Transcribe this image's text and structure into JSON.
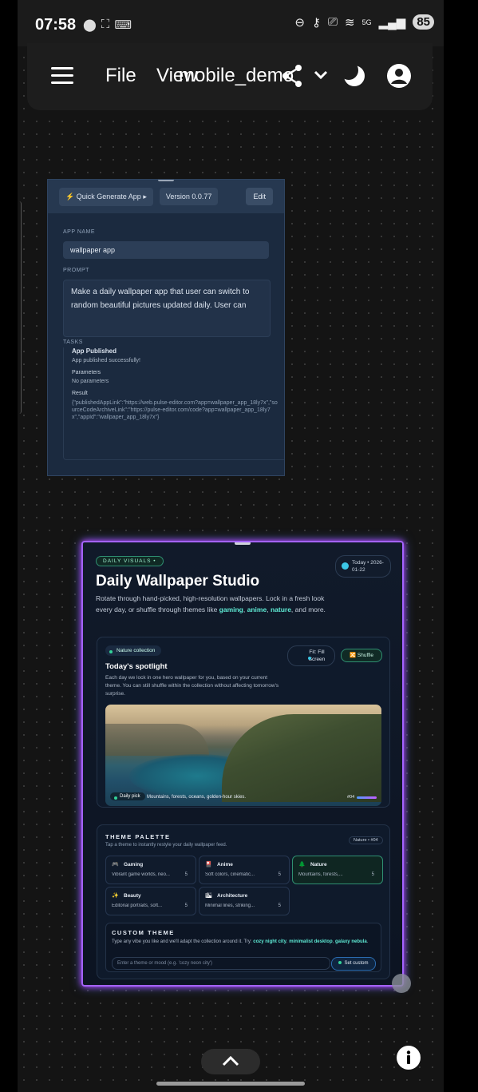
{
  "status_bar": {
    "time": "07:58",
    "network": "5G",
    "battery": "85"
  },
  "app_bar": {
    "file_label": "File",
    "view_label": "View",
    "project_name": "mobile_demo"
  },
  "quick_generate": {
    "title": "Quick Generate App",
    "version": "Version 0.0.77",
    "edit_label": "Edit",
    "app_name_label": "APP NAME",
    "app_name_value": "wallpaper app",
    "prompt_label": "PROMPT",
    "prompt_value": "Make a daily wallpaper app that user can switch to random beautiful pictures updated daily. User can",
    "tasks_label": "TASKS",
    "task_title": "App Published",
    "task_message": "App published successfully!",
    "parameters_label": "Parameters",
    "parameters_value": "No parameters",
    "result_label": "Result",
    "result_value": "{\"publishedAppLink\":\"https://web.pulse-editor.com?app=wallpaper_app_18ly7x\",\"sourceCodeArchiveLink\":\"https://pulse-editor.com/code?app=wallpaper_app_18ly7x\",\"appId\":\"wallpaper_app_18ly7x\"}"
  },
  "wallpaper_preview": {
    "badge": "DAILY VISUALS",
    "today": "Today • 2026-01-22",
    "title": "Daily Wallpaper Studio",
    "desc_pre": "Rotate through hand-picked, high-resolution wallpapers. Lock in a fresh look every day, or shuffle through themes like ",
    "desc_gaming": "gaming",
    "desc_sep1": ", ",
    "desc_anime": "anime",
    "desc_sep2": ", ",
    "desc_nature": "nature",
    "desc_post": ", and more.",
    "collection": "Nature collection",
    "spotlight_title": "Today's spotlight",
    "spotlight_desc": "Each day we lock in one hero wallpaper for you, based on your current theme. You can still shuffle within the collection without affecting tomorrow's surprise.",
    "fit_label": "Fit: Fill Screen",
    "shuffle_label": "Shuffle",
    "daily_pick": "Daily pick",
    "caption": "Mountains, forests, oceans, golden-hour skies.",
    "counter": "#04",
    "palette_title": "THEME PALETTE",
    "palette_sub": "Tap a theme to instantly restyle your daily wallpaper feed.",
    "palette_selected": "Nature • #04",
    "themes": [
      {
        "icon": "🎮",
        "name": "Gaming",
        "desc": "Vibrant game worlds, neo...",
        "count": "5"
      },
      {
        "icon": "🎴",
        "name": "Anime",
        "desc": "Soft colors, cinematic...",
        "count": "5"
      },
      {
        "icon": "🌲",
        "name": "Nature",
        "desc": "Mountains, forests,...",
        "count": "5"
      },
      {
        "icon": "✨",
        "name": "Beauty",
        "desc": "Editorial portraits, soft...",
        "count": "5"
      },
      {
        "icon": "🏙",
        "name": "Architecture",
        "desc": "Minimal lines, striking...",
        "count": "5"
      }
    ],
    "custom_title": "CUSTOM THEME",
    "custom_desc_pre": "Type any vibe you like and we'll adapt the collection around it. Try: ",
    "custom_ex1": "cozy night city",
    "custom_sep1": ", ",
    "custom_ex2": "minimalist desktop",
    "custom_sep2": ", ",
    "custom_ex3": "galaxy nebula",
    "custom_post": ".",
    "custom_placeholder": "Enter a theme or mood (e.g. 'cozy neon city')",
    "set_custom_label": "Set custom"
  },
  "colors": {
    "accent": "#5eead4",
    "frame_glow": "#a463ff",
    "panel": "#1b2a3f"
  }
}
